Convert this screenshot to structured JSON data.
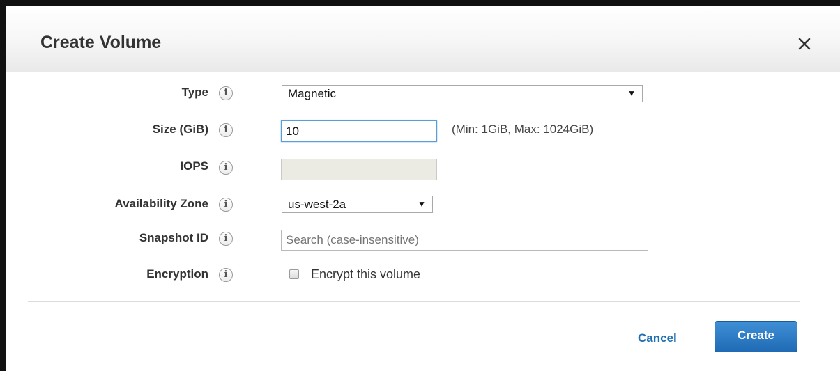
{
  "dialog": {
    "title": "Create Volume",
    "close_icon": "close-icon"
  },
  "fields": {
    "type": {
      "label": "Type",
      "info_icon": "info-icon",
      "value": "Magnetic"
    },
    "size": {
      "label": "Size (GiB)",
      "info_icon": "info-icon",
      "value": "10",
      "hint": "(Min: 1GiB, Max: 1024GiB)"
    },
    "iops": {
      "label": "IOPS",
      "info_icon": "info-icon",
      "value": ""
    },
    "availability_zone": {
      "label": "Availability Zone",
      "info_icon": "info-icon",
      "value": "us-west-2a"
    },
    "snapshot_id": {
      "label": "Snapshot ID",
      "info_icon": "info-icon",
      "value": "",
      "placeholder": "Search (case-insensitive)"
    },
    "encryption": {
      "label": "Encryption",
      "info_icon": "info-icon",
      "checkbox_label": "Encrypt this volume",
      "checked": false
    }
  },
  "footer": {
    "cancel_label": "Cancel",
    "create_label": "Create"
  },
  "colors": {
    "link": "#1f6fb3",
    "primary_button": "#2a7bc4",
    "focus_border": "#5b9dd9"
  }
}
